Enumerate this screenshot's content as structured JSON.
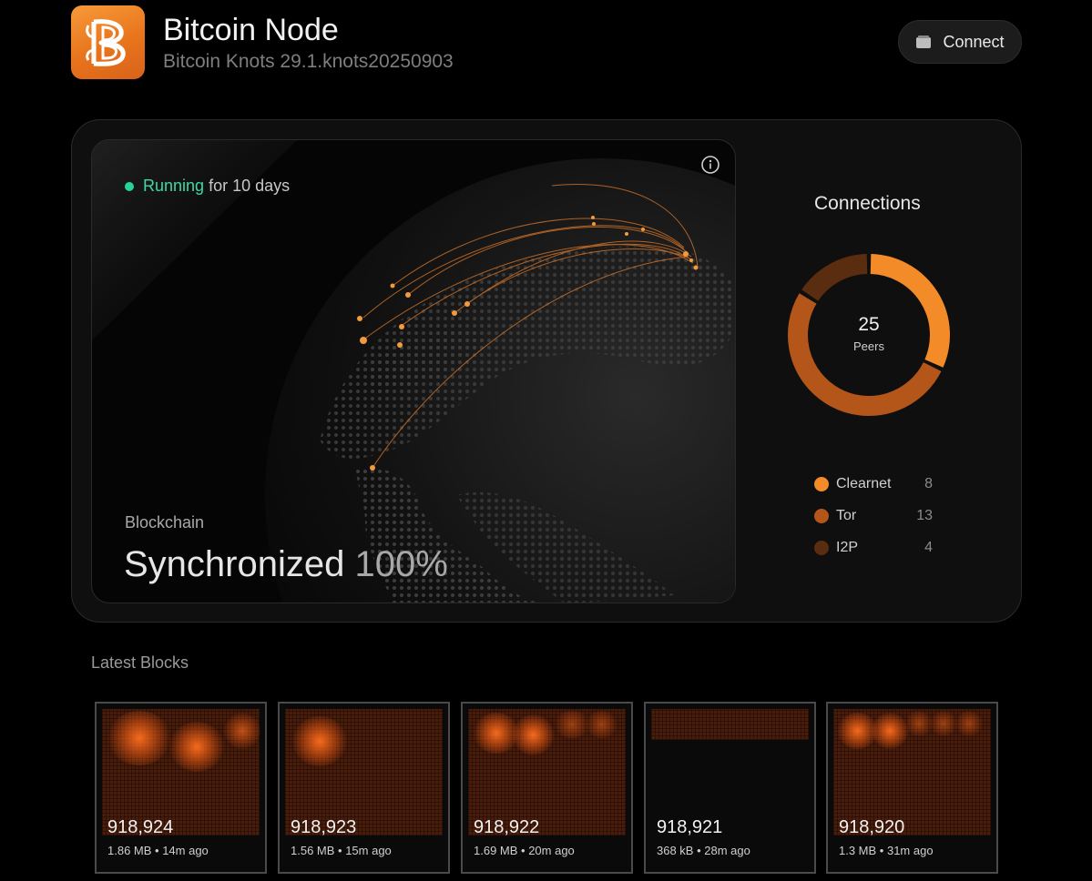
{
  "header": {
    "title": "Bitcoin Node",
    "subtitle": "Bitcoin Knots 29.1.knots20250903",
    "connect_label": "Connect"
  },
  "status": {
    "running_label": "Running",
    "running_detail": "for 10 days"
  },
  "blockchain": {
    "label": "Blockchain",
    "status": "Synchronized",
    "percent": "100%"
  },
  "connections": {
    "title": "Connections",
    "total": "25",
    "total_label": "Peers",
    "types": [
      {
        "name": "Clearnet",
        "count": "8",
        "color": "#f38b28"
      },
      {
        "name": "Tor",
        "count": "13",
        "color": "#b4561a"
      },
      {
        "name": "I2P",
        "count": "4",
        "color": "#5a2c10"
      }
    ]
  },
  "latest_blocks": {
    "title": "Latest Blocks",
    "blocks": [
      {
        "height": "918,924",
        "size": "1.86 MB",
        "age": "14m ago",
        "meta": "1.86 MB • 14m ago"
      },
      {
        "height": "918,923",
        "size": "1.56 MB",
        "age": "15m ago",
        "meta": "1.56 MB • 15m ago"
      },
      {
        "height": "918,922",
        "size": "1.69 MB",
        "age": "20m ago",
        "meta": "1.69 MB • 20m ago"
      },
      {
        "height": "918,921",
        "size": "368 kB",
        "age": "28m ago",
        "meta": "368 kB • 28m ago"
      },
      {
        "height": "918,920",
        "size": "1.3 MB",
        "age": "31m ago",
        "meta": "1.3 MB • 31m ago"
      }
    ]
  },
  "icons": {
    "app": "bitcoin-knots-logo",
    "connect": "wallet-icon",
    "info": "info-icon",
    "status": "status-dot"
  }
}
